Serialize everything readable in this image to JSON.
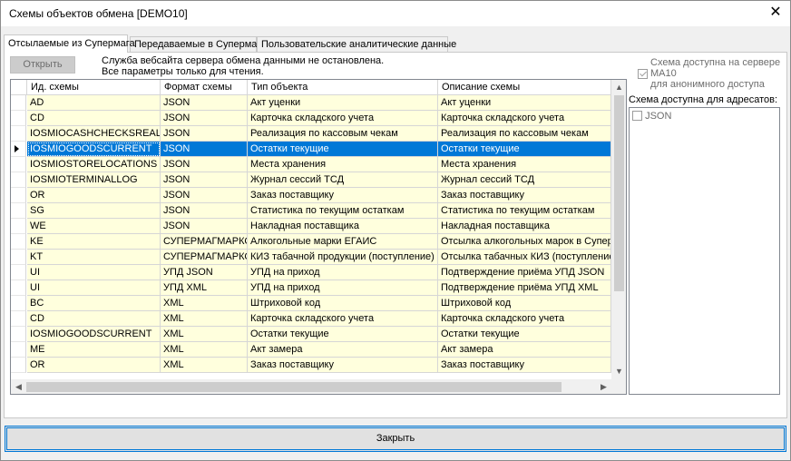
{
  "window": {
    "title": "Схемы объектов обмена [DEMO10]",
    "close_glyph": "✕"
  },
  "tabs": [
    {
      "label": "Отсылаемые из Супермага",
      "active": true
    },
    {
      "label": "Передаваемые в Супермаг",
      "active": false
    },
    {
      "label": "Пользовательские аналитические данные",
      "active": false
    }
  ],
  "toolbar": {
    "open_label": "Открыть"
  },
  "notice": {
    "line1": "Служба вебсайта сервера обмена данными не остановлена.",
    "line2": "Все параметры только для чтения."
  },
  "grid": {
    "columns": [
      "Ид. схемы",
      "Формат схемы",
      "Тип объекта",
      "Описание схемы"
    ],
    "rows": [
      [
        "AD",
        "JSON",
        "Акт уценки",
        "Акт уценки"
      ],
      [
        "CD",
        "JSON",
        "Карточка складского учета",
        "Карточка складского учета"
      ],
      [
        "IOSMIOCASHCHECKSREAL",
        "JSON",
        "Реализация по кассовым чекам",
        "Реализация по кассовым чекам"
      ],
      [
        "IOSMIOGOODSCURRENT",
        "JSON",
        "Остатки текущие",
        "Остатки текущие"
      ],
      [
        "IOSMIOSTORELOCATIONS",
        "JSON",
        "Места хранения",
        "Места хранения"
      ],
      [
        "IOSMIOTERMINALLOG",
        "JSON",
        "Журнал сессий ТСД",
        "Журнал сессий ТСД"
      ],
      [
        "OR",
        "JSON",
        "Заказ поставщику",
        "Заказ поставщику"
      ],
      [
        "SG",
        "JSON",
        "Статистика по текущим остаткам",
        "Статистика по текущим остаткам"
      ],
      [
        "WE",
        "JSON",
        "Накладная поставщика",
        "Накладная поставщика"
      ],
      [
        "KE",
        "СУПЕРМАГМАРКО",
        "Алкогольные марки ЕГАИС",
        "Отсылка алкогольных марок в СуперМ."
      ],
      [
        "KT",
        "СУПЕРМАГМАРКО",
        "КИЗ табачной продукции (поступление)",
        "Отсылка табачных КИЗ (поступление)"
      ],
      [
        "UI",
        "УПД JSON",
        "УПД на приход",
        "Подтверждение приёма УПД JSON"
      ],
      [
        "UI",
        "УПД XML",
        "УПД на приход",
        "Подтверждение приёма УПД XML"
      ],
      [
        "BC",
        "XML",
        "Штриховой код",
        "Штриховой код"
      ],
      [
        "CD",
        "XML",
        "Карточка складского учета",
        "Карточка складского учета"
      ],
      [
        "IOSMIOGOODSCURRENT",
        "XML",
        "Остатки текущие",
        "Остатки текущие"
      ],
      [
        "ME",
        "XML",
        "Акт замера",
        "Акт замера"
      ],
      [
        "OR",
        "XML",
        "Заказ поставщику",
        "Заказ поставщику"
      ]
    ],
    "selected_row_index": 3
  },
  "scroll": {
    "up": "▲",
    "down": "▼",
    "left": "◀",
    "right": "▶"
  },
  "right_panel": {
    "availability_label_1": "Схема доступна на сервере",
    "server_name": "MA10",
    "availability_label_2": "для анонимного доступа",
    "anonymous_checked": true,
    "recipients_label": "Схема доступна для адресатов:",
    "recipients": [
      {
        "label": "JSON",
        "checked": false
      }
    ]
  },
  "footer": {
    "close_label": "Закрыть"
  },
  "colors": {
    "row_bg": "#ffffdd",
    "selected_bg": "#0078d7",
    "accent": "#0078d7"
  }
}
